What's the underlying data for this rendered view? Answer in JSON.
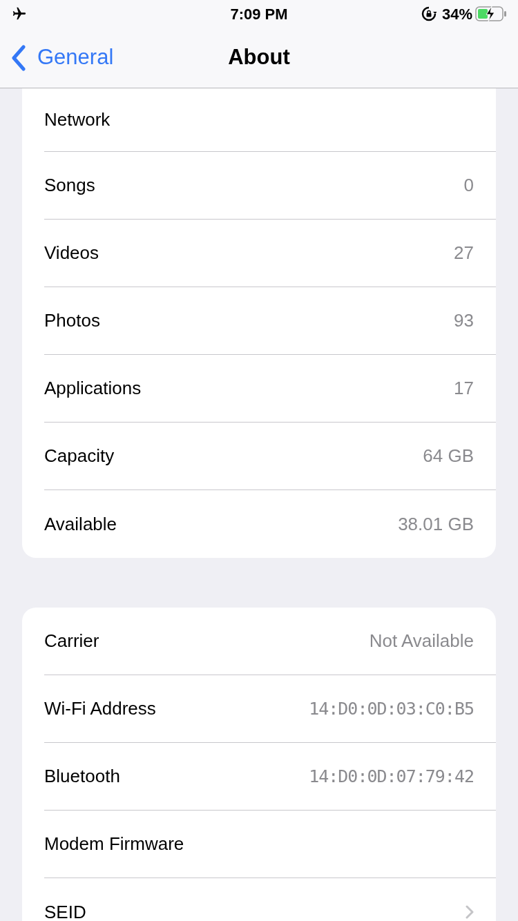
{
  "status_bar": {
    "time": "7:09 PM",
    "battery": "34%",
    "airplane_mode": true,
    "charging": true
  },
  "nav": {
    "back": "General",
    "title": "About"
  },
  "sections": [
    {
      "top_cut": true,
      "rows": [
        {
          "kind": "label",
          "label": "Network"
        },
        {
          "kind": "value",
          "label": "Songs",
          "value": "0"
        },
        {
          "kind": "value",
          "label": "Videos",
          "value": "27"
        },
        {
          "kind": "value",
          "label": "Photos",
          "value": "93"
        },
        {
          "kind": "value",
          "label": "Applications",
          "value": "17"
        },
        {
          "kind": "value",
          "label": "Capacity",
          "value": "64 GB"
        },
        {
          "kind": "value",
          "label": "Available",
          "value": "38.01 GB"
        }
      ]
    },
    {
      "top_cut": false,
      "rows": [
        {
          "kind": "value",
          "label": "Carrier",
          "value": "Not Available"
        },
        {
          "kind": "address",
          "label": "Wi-Fi Address",
          "value": "14:D0:0D:03:C0:B5"
        },
        {
          "kind": "address",
          "label": "Bluetooth",
          "value": "14:D0:0D:07:79:42"
        },
        {
          "kind": "label",
          "label": "Modem Firmware"
        },
        {
          "kind": "chevron",
          "label": "SEID"
        }
      ]
    }
  ]
}
